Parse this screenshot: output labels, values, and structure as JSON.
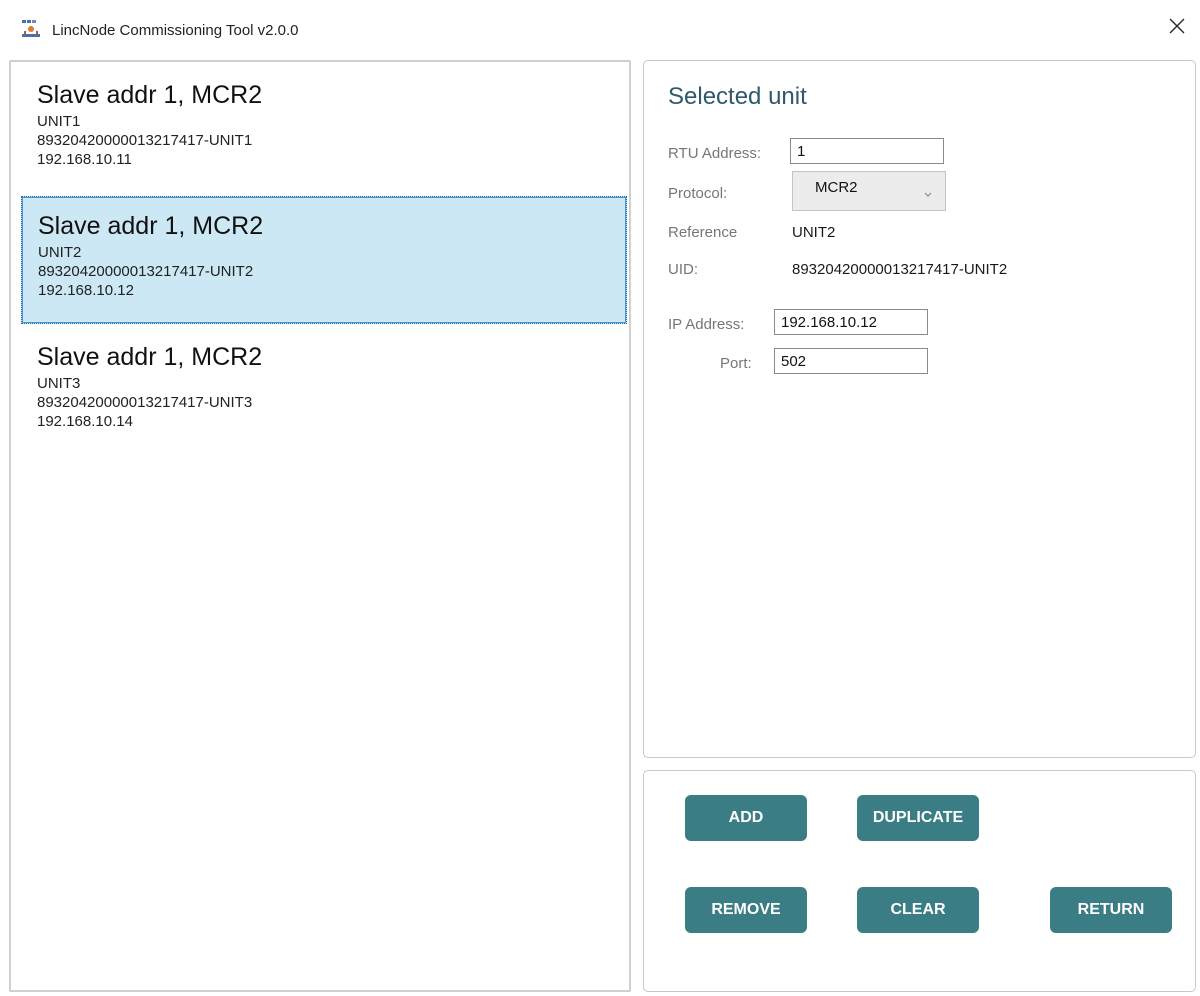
{
  "window": {
    "title": "LincNode Commissioning Tool v2.0.0",
    "icon": "lincnode-logo-icon",
    "close_icon": "close-icon"
  },
  "units": [
    {
      "title": "Slave addr 1, MCR2",
      "reference": "UNIT1",
      "uid": "89320420000013217417-UNIT1",
      "ip": "192.168.10.11",
      "selected": false
    },
    {
      "title": "Slave addr 1, MCR2",
      "reference": "UNIT2",
      "uid": "89320420000013217417-UNIT2",
      "ip": "192.168.10.12",
      "selected": true
    },
    {
      "title": "Slave addr 1, MCR2",
      "reference": "UNIT3",
      "uid": "89320420000013217417-UNIT3",
      "ip": "192.168.10.14",
      "selected": false
    }
  ],
  "selected_unit": {
    "heading": "Selected unit",
    "rtu_address_label": "RTU Address:",
    "rtu_address_value": "1",
    "protocol_label": "Protocol:",
    "protocol_value": "MCR2",
    "reference_label": "Reference",
    "reference_value": "UNIT2",
    "uid_label": "UID:",
    "uid_value": "89320420000013217417-UNIT2",
    "ip_label": "IP Address:",
    "ip_value": "192.168.10.12",
    "port_label": "Port:",
    "port_value": "502"
  },
  "actions": {
    "add": "ADD",
    "duplicate": "DUPLICATE",
    "remove": "REMOVE",
    "clear": "CLEAR",
    "return": "RETURN"
  },
  "colors": {
    "accent_button": "#3a7d84",
    "selection_bg": "#cce8f4",
    "heading": "#2e5a6b"
  }
}
